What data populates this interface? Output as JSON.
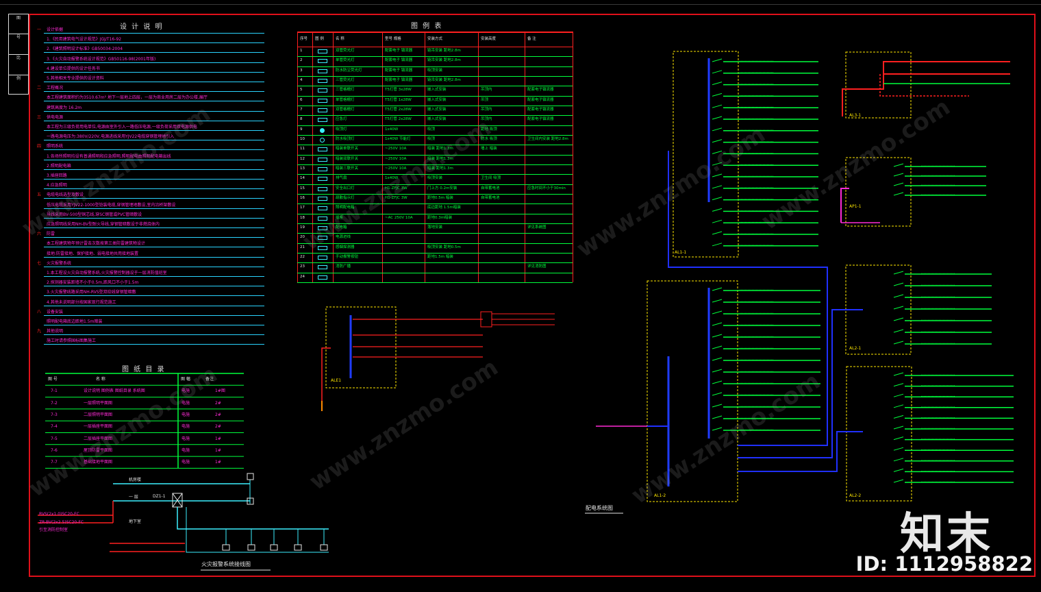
{
  "title_block": {
    "cells": [
      "图",
      "号",
      "比",
      "例"
    ]
  },
  "design_notes": {
    "title": "设 计 说 明",
    "numbers": [
      "一",
      "二",
      "三",
      "四",
      "五",
      "六",
      "七",
      "八",
      "九"
    ],
    "lines": [
      {
        "text": "设计依据",
        "color": "mag"
      },
      {
        "text": "1.《民用建筑电气设计规范》JGJ/T16-92",
        "color": "mag"
      },
      {
        "text": "2.《建筑照明设计标准》GB50034-2004",
        "color": "mag"
      },
      {
        "text": "3.《火灾自动报警系统设计规范》GB50116-98(2001年版)",
        "color": "mag"
      },
      {
        "text": "4.建设单位提供的设计任务书",
        "color": "mag"
      },
      {
        "text": "5.其他相关专业提供的设计资料",
        "color": "mag"
      },
      {
        "text": "工程概况",
        "color": "mag"
      },
      {
        "text": "本工程建筑面积约为3510.67m² 地下一层地上四层，一层为商业用房二层为办公楼,展厅",
        "color": "mag"
      },
      {
        "text": "建筑高度为 16.2m",
        "color": "mag"
      },
      {
        "text": "供电电源",
        "color": "mag"
      },
      {
        "text": "本工程为三级负荷用电单位,电源由室外引入一路低压电源,一级负荷采用双电源供电",
        "color": "mag"
      },
      {
        "text": "一路电源电压为:380V/220V,电源进线采用YJV22电缆穿钢管埋地引入",
        "color": "mag"
      },
      {
        "text": "照明系统",
        "color": "mag"
      },
      {
        "text": "1.各场所照明均设有普通照明和应急照明,照明配电由照明配电箱出线",
        "color": "mag"
      },
      {
        "text": "2.照明配电箱",
        "color": "mag"
      },
      {
        "text": "3.插座回路",
        "color": "mag"
      },
      {
        "text": "4.应急照明",
        "color": "mag"
      },
      {
        "text": "电缆电线选型及敷设",
        "color": "mag"
      },
      {
        "text": "低压电缆采用YJV22-1000型铠装电缆,穿钢管埋地敷设,室内沿桥架敷设",
        "color": "mag"
      },
      {
        "text": "导线采用BV-500型铜芯线,穿SC钢管或PVC管暗敷设",
        "color": "mag"
      },
      {
        "text": "应急照明线采用NH-BV型耐火导线,穿钢管暗敷设于非燃烧体内",
        "color": "mag"
      },
      {
        "text": "防雷",
        "color": "mag"
      },
      {
        "text": "本工程建筑物年预计雷击次数按第三类防雷建筑物设计",
        "color": "mag"
      },
      {
        "text": "接地:防雷接地、保护接地、弱电接地共用接地装置",
        "color": "mag"
      },
      {
        "text": "火灾报警系统",
        "color": "mag"
      },
      {
        "text": "1.本工程设火灾自动报警系统,火灾报警控制器设于一层消防值班室",
        "color": "mag"
      },
      {
        "text": "2.探测器安装距墙不小于0.5m,距风口不小于1.5m",
        "color": "mag"
      },
      {
        "text": "3.火灾报警线路采用NH-RVS型双绞线穿钢管暗敷",
        "color": "mag"
      },
      {
        "text": "4.其他未说明部分按国家现行规范施工",
        "color": "mag"
      },
      {
        "text": "设备安装",
        "color": "mag"
      },
      {
        "text": "照明配电箱底边距地1.5m暗装",
        "color": "mag"
      },
      {
        "text": "其他说明",
        "color": "mag"
      },
      {
        "text": "施工时请参照国标图集施工",
        "color": "mag"
      }
    ]
  },
  "drawing_list": {
    "title": "图 纸 目 录",
    "headers": [
      "图 号",
      "名 称",
      "图 幅",
      "备注"
    ],
    "rows": [
      [
        "7-1",
        "设计说明 图例表 图纸目录 系统图",
        "电施",
        "1#图"
      ],
      [
        "7-2",
        "一层照明平面图",
        "电施",
        "2#"
      ],
      [
        "7-3",
        "二层照明平面图",
        "电施",
        "2#"
      ],
      [
        "7-4",
        "一层插座平面图",
        "电施",
        "2#"
      ],
      [
        "7-5",
        "二层插座平面图",
        "电施",
        "1#"
      ],
      [
        "7-6",
        "屋顶防雷平面图",
        "电施",
        "1#"
      ],
      [
        "7-7",
        "基础接地平面图",
        "电施",
        "1#"
      ]
    ]
  },
  "legend_table": {
    "title": "图 例 表",
    "headers": [
      "序号",
      "图 例",
      "名 称",
      "型号 规格",
      "安装方式",
      "安装高度",
      "备 注"
    ],
    "rows": [
      [
        "1",
        "",
        "双管荧光灯",
        "配套电子 镇流器",
        "链吊安装 距地2.8m",
        "",
        ""
      ],
      [
        "2",
        "",
        "单管荧光灯",
        "配套电子 镇流器",
        "链吊安装 距地2.8m",
        "",
        ""
      ],
      [
        "3",
        "",
        "防水防尘荧光灯",
        "配套电子 镇流器",
        "吸顶安装",
        "",
        ""
      ],
      [
        "4",
        "",
        "三管荧光灯",
        "配套电子 镇流器",
        "链吊安装 距地2.8m",
        "",
        ""
      ],
      [
        "5",
        "",
        "三管格栅灯",
        "T5灯管 3x28W",
        "嵌入式安装",
        "吊顶内",
        "配套电子镇流器"
      ],
      [
        "6",
        "",
        "单管格栅灯",
        "T5灯管 1x28W",
        "嵌入式安装",
        "吊顶",
        "配套电子镇流器"
      ],
      [
        "7",
        "",
        "双管格栅灯",
        "T5灯管 2x28W",
        "嵌入式安装",
        "吊顶内",
        "配套电子镇流器"
      ],
      [
        "8",
        "",
        "应急灯",
        "T5灯管 2x28W",
        "嵌入式安装",
        "吊顶内",
        "配套电子镇流器"
      ],
      [
        "9",
        "",
        "吸顶灯",
        "1x40W",
        "吸顶",
        "距地 吸顶",
        ""
      ],
      [
        "10",
        "",
        "防水吸顶灯",
        "1x40W 节能灯",
        "吸顶",
        "防水 吸顶",
        "卫生间内安装 距地2.8m"
      ],
      [
        "11",
        "",
        "暗装单联开关",
        "~250V 10A",
        "暗装 距地1.3m",
        "墙上 暗装",
        ""
      ],
      [
        "12",
        "",
        "暗装双联开关",
        "~250V 10A",
        "暗装 距地1.3m",
        "",
        ""
      ],
      [
        "13",
        "",
        "暗装三联开关",
        "~250V 10A",
        "暗装 距地1.3m",
        "",
        ""
      ],
      [
        "14",
        "",
        "排气扇",
        "1x40W",
        "吸顶安装",
        "卫生间 吸顶",
        ""
      ],
      [
        "15",
        "",
        "安全出口灯",
        "H1-ZFJC 3W",
        "门上方 0.2m安装",
        "自带蓄电池",
        "应急时间不小于30min"
      ],
      [
        "16",
        "",
        "疏散指示灯",
        "H1-ZFJC 3W",
        "距地0.5m 暗装",
        "自带蓄电池",
        ""
      ],
      [
        "17",
        "",
        "照明配电箱",
        "",
        "底边距地 1.5m暗装",
        "",
        ""
      ],
      [
        "18",
        "",
        "插座",
        "~AC 250V 10A",
        "距地0.3m暗装",
        "",
        ""
      ],
      [
        "19",
        "",
        "配电箱",
        "",
        "落地安装",
        "",
        "详见系统图"
      ],
      [
        "20",
        "",
        "电源进线",
        "",
        "",
        "",
        ""
      ],
      [
        "21",
        "",
        "感烟探测器",
        "",
        "吸顶安装 距地0.5m",
        "",
        ""
      ],
      [
        "22",
        "",
        "手动报警按钮",
        "",
        "距地1.5m 暗装",
        "",
        ""
      ],
      [
        "23",
        "",
        "消防广播",
        "",
        "",
        "",
        "详见消防图"
      ],
      [
        "24",
        "",
        "",
        "",
        "",
        "",
        ""
      ]
    ]
  },
  "fire_alarm": {
    "title": "火灾报警系统接线图",
    "labels": [
      "机房楼",
      "一 层",
      "DZ1-1",
      "地下室",
      "RVS(2x1.0)SC20-FC",
      "ZR-BV(2x2.5)SC20-FC",
      "引至消防控制室"
    ]
  },
  "distribution": {
    "title": "配电系统图",
    "boxes": [
      "ALE1",
      "AL1-1",
      "AL1-2",
      "AL2-1",
      "AL2-2",
      "AL3-1",
      "AP1-1"
    ]
  },
  "watermark": {
    "brand": "知末",
    "id": "ID: 1112958822",
    "site": "www.znzmo.com"
  }
}
